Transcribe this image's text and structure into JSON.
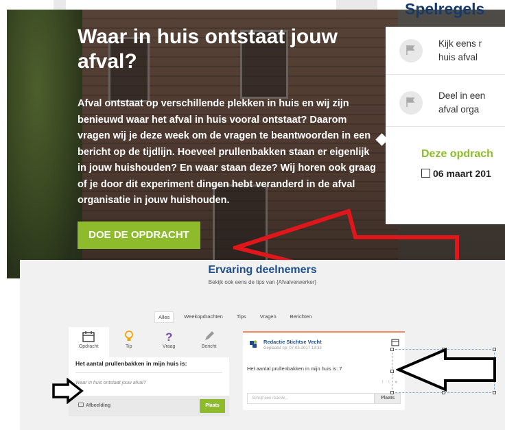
{
  "hero": {
    "title": "Waar in huis ontstaat jouw afval?",
    "body": "Afval ontstaat op verschillende plekken in huis en wij zijn benieuwd waar het afval in huis vooral ontstaat? Daarom vragen wij je deze week om de vragen te beantwoorden in een bericht op de tijdlijn. Hoeveel prullenbakken staan er eigenlijk in jouw huishouden? En waar staan deze? Wij horen ook graag of je door dit experiment dingen hebt veranderd in de afval organisatie in jouw huishouden.",
    "cta": "DOE DE OPDRACHT"
  },
  "side": {
    "heading": "Spelregels",
    "rows": [
      {
        "line1": "Kijk eens r",
        "line2": "huis afval"
      },
      {
        "line1": "Deel in een",
        "line2": "afval orga"
      }
    ],
    "assignment": "Deze opdrach",
    "date": "06 maart 201"
  },
  "bottom": {
    "title": "Ervaring deelnemers",
    "subtitle": "Bekijk ook eens de tips van {Afvalverwerker}",
    "filters": [
      "Alles",
      "Weekopdrachten",
      "Tips",
      "Vragen",
      "Berichten"
    ],
    "composer": {
      "tabs": [
        "Opdracht",
        "Tip",
        "Vraag",
        "Bericht"
      ],
      "question": "Het aantal prullenbakken in mijn huis is:",
      "input_placeholder": "Waar in huis ontstaat jouw afval?",
      "image_label": "Afbeelding",
      "submit": "Plaats"
    },
    "post": {
      "author": "Redactie Stichtse Vecht",
      "meta": "Geplaatst op: 07-03-2017 13:33",
      "text": "Het aantal prullenbakken in mijn huis is: 7",
      "social": "f t ♥",
      "reply_placeholder": "Schrijf een reactie...",
      "reply_button": "Plaats"
    }
  },
  "colors": {
    "green": "#8dbb2b",
    "navy": "#1d4d8a",
    "red_arrow": "#e0161b",
    "post_accent": "#f08a5d"
  }
}
